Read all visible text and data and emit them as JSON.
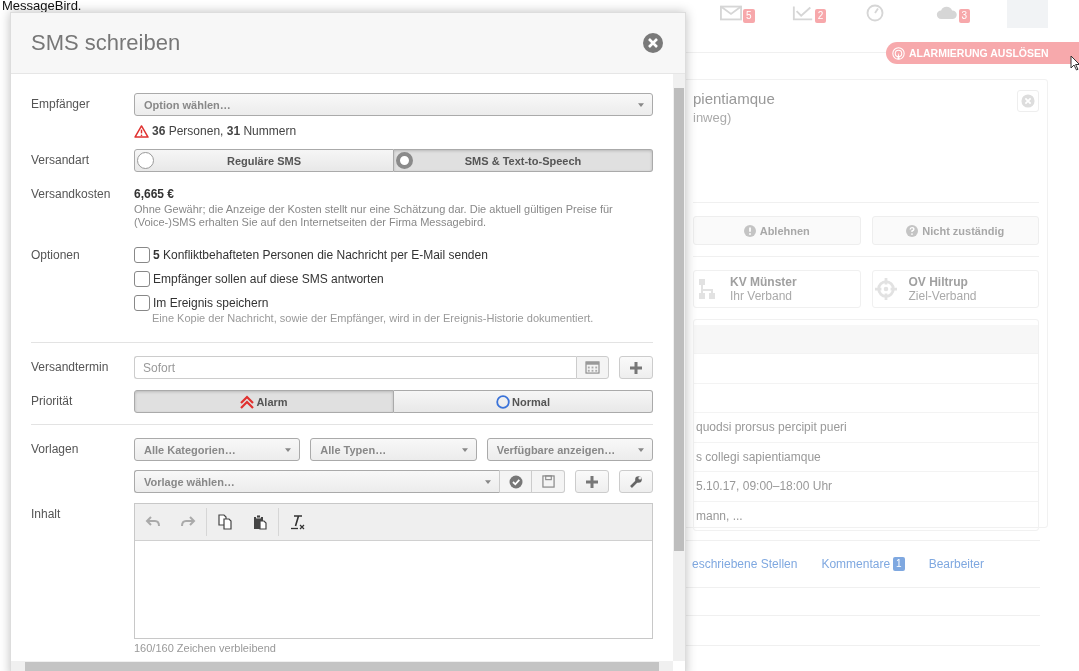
{
  "page_heading": "MessageBird.",
  "background": {
    "notifications": [
      {
        "kind": "mail",
        "count": "5"
      },
      {
        "kind": "tasks",
        "count": "2"
      },
      {
        "kind": "clock"
      },
      {
        "kind": "cloud",
        "count": "3"
      }
    ],
    "alarm_button": "ALARMIERUNG AUSLÖSEN",
    "event": {
      "title": "pientiamque",
      "subtitle": "inweg)"
    },
    "actions": [
      {
        "label": "Ablehnen",
        "kind": "exclamation"
      },
      {
        "label": "Nicht zuständig",
        "kind": "question"
      }
    ],
    "route": [
      {
        "name": "KV Münster",
        "role": "Ihr Verband",
        "kind": "org"
      },
      {
        "name": "OV Hiltrup",
        "role": "Ziel-Verband",
        "kind": "target"
      }
    ],
    "details": [
      "quodsi prorsus percipit pueri",
      "s collegi sapientiamque",
      "5.10.17, 09:00–18:00 Uhr",
      "mann, ..."
    ],
    "tabs": [
      {
        "label": "eschriebene Stellen"
      },
      {
        "label": "Kommentare",
        "badge": "1"
      },
      {
        "label": "Bearbeiter"
      }
    ]
  },
  "dialog": {
    "title": "SMS schreiben",
    "recipients": {
      "label": "Empfänger",
      "prompt": "Option wählen…",
      "summary": "**36** Personen, **31** Nummern"
    },
    "send_type": {
      "label": "Versandart",
      "options": [
        {
          "label": "Reguläre SMS",
          "selected": false
        },
        {
          "label": "SMS & Text-to-Speech",
          "selected": true
        }
      ]
    },
    "cost": {
      "label": "Versandkosten",
      "amount": "6,665 €",
      "note": "Ohne Gewähr; die Anzeige der Kosten stellt nur eine Schätzung dar. Die aktuell gültigen Preise für (Voice-)SMS erhalten Sie auf den Internetseiten der Firma Messagebird."
    },
    "options": {
      "label": "Optionen",
      "items": [
        {
          "text": "**5** Konfliktbehafteten Personen die Nachricht per E-Mail senden",
          "checked": false
        },
        {
          "text": "Empfänger sollen auf diese SMS antworten",
          "checked": false
        },
        {
          "text": "Im Ereignis speichern",
          "checked": false,
          "hint": "Eine Kopie der Nachricht, sowie der Empfänger, wird in der Ereignis-Historie dokumentiert."
        }
      ]
    },
    "schedule": {
      "label": "Versandtermin",
      "placeholder": "Sofort"
    },
    "priority": {
      "label": "Priorität",
      "options": [
        {
          "label": "Alarm",
          "kind": "alarm",
          "selected": true
        },
        {
          "label": "Normal",
          "kind": "normal",
          "selected": false
        }
      ]
    },
    "templates": {
      "label": "Vorlagen",
      "filters": [
        "Alle Kategorien…",
        "Alle Typen…",
        "Verfügbare anzeigen…"
      ],
      "template_prompt": "Vorlage wählen…"
    },
    "content": {
      "label": "Inhalt",
      "counter": "160/160 Zeichen verbleibend"
    }
  }
}
